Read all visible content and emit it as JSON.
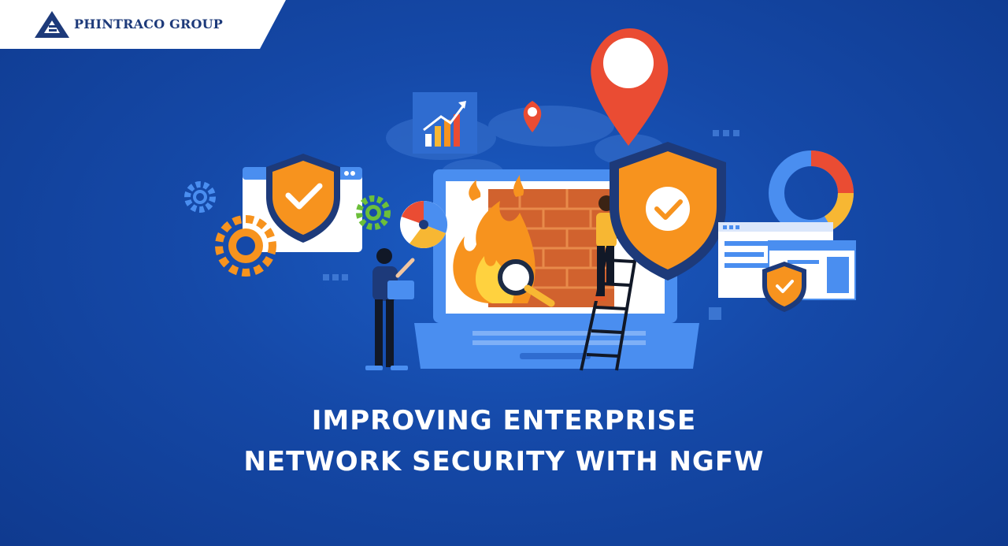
{
  "brand": {
    "name": "PHINTRACO GROUP",
    "logo_icon": "phintraco-logo-icon"
  },
  "headline": {
    "line1": "IMPROVING ENTERPRISE",
    "line2": "NETWORK SECURITY WITH NGFW"
  },
  "colors": {
    "background": "#1549a8",
    "accent_orange": "#f7931e",
    "accent_red": "#ea4c33",
    "brand_navy": "#1d3a7a",
    "laptop_blue": "#4a8ef0"
  },
  "illustration": {
    "icons": [
      "world-map-icon",
      "location-pin-icon",
      "shield-check-icon",
      "gear-icon",
      "firewall-brick-wall-icon",
      "fire-icon",
      "magnifier-icon",
      "laptop-icon",
      "ladder-icon",
      "person-with-laptop-icon",
      "person-on-ladder-icon",
      "donut-chart-icon",
      "pie-chart-icon",
      "bar-chart-icon",
      "browser-window-icon"
    ]
  }
}
